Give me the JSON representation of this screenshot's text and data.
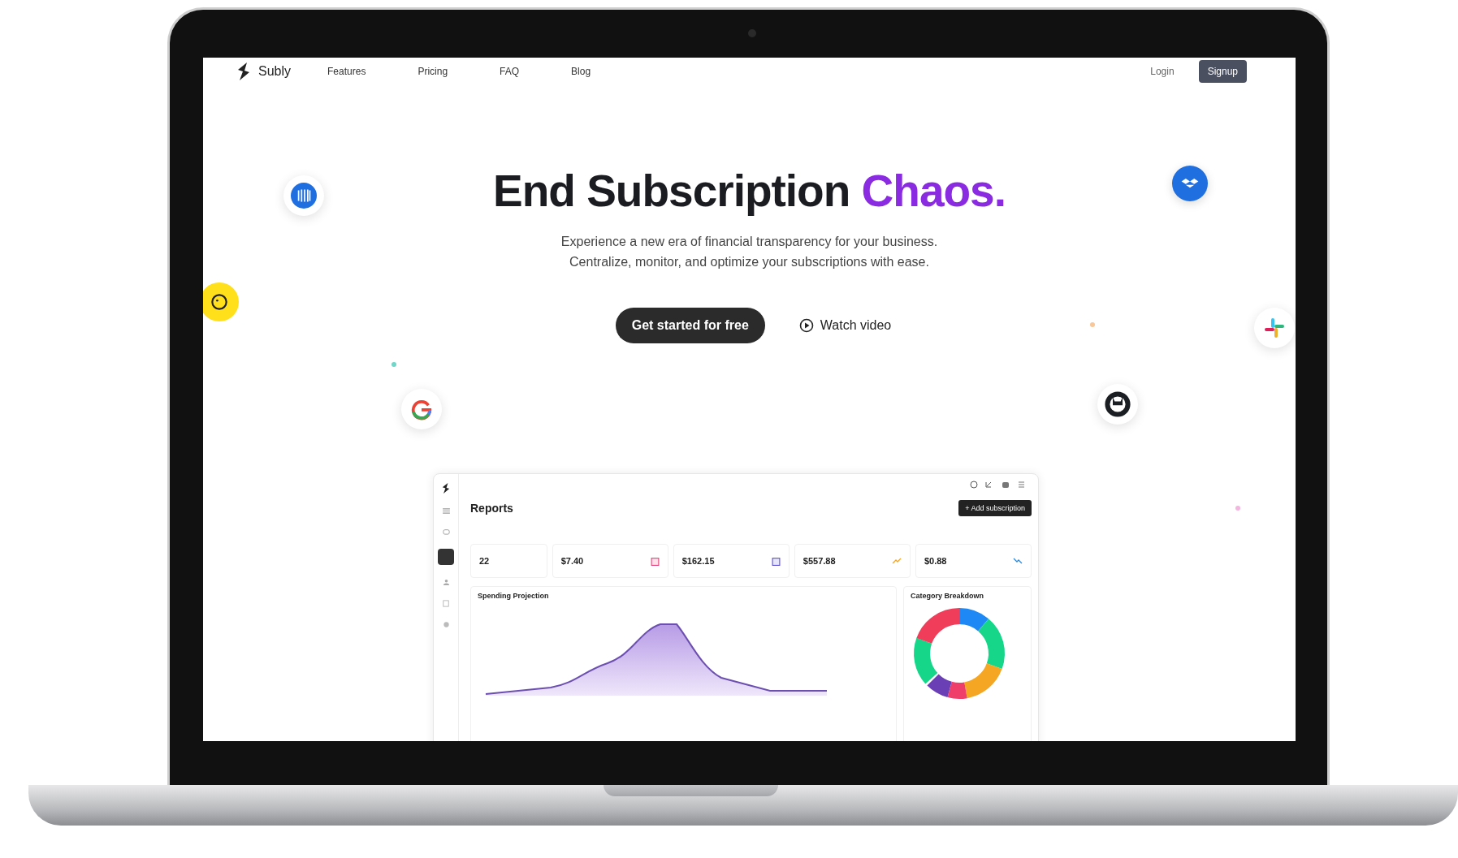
{
  "nav": {
    "brand": "Subly",
    "links": [
      "Features",
      "Pricing",
      "FAQ",
      "Blog"
    ],
    "login": "Login",
    "signup": "Signup"
  },
  "hero": {
    "title": "End Subscription",
    "title_accent": "Chaos.",
    "subtitle": [
      "Experience a new era of financial transparency for your business.",
      "Centralize, monitor, and optimize your subscriptions with ease."
    ],
    "primary_button": "Get started for free",
    "video_button": "Watch video"
  },
  "dashboard": {
    "title": "Reports",
    "add_button": "+ Add subscription",
    "stats": [
      {
        "value": "22",
        "kind": "plain"
      },
      {
        "value": "$7.40",
        "kind": "calendar"
      },
      {
        "value": "$162.15",
        "kind": "card"
      },
      {
        "value": "$557.88",
        "kind": "trend-up"
      },
      {
        "value": "$0.88",
        "kind": "trend-down"
      }
    ],
    "projection_title": "Spending Projection",
    "breakdown_title": "Category Breakdown"
  }
}
